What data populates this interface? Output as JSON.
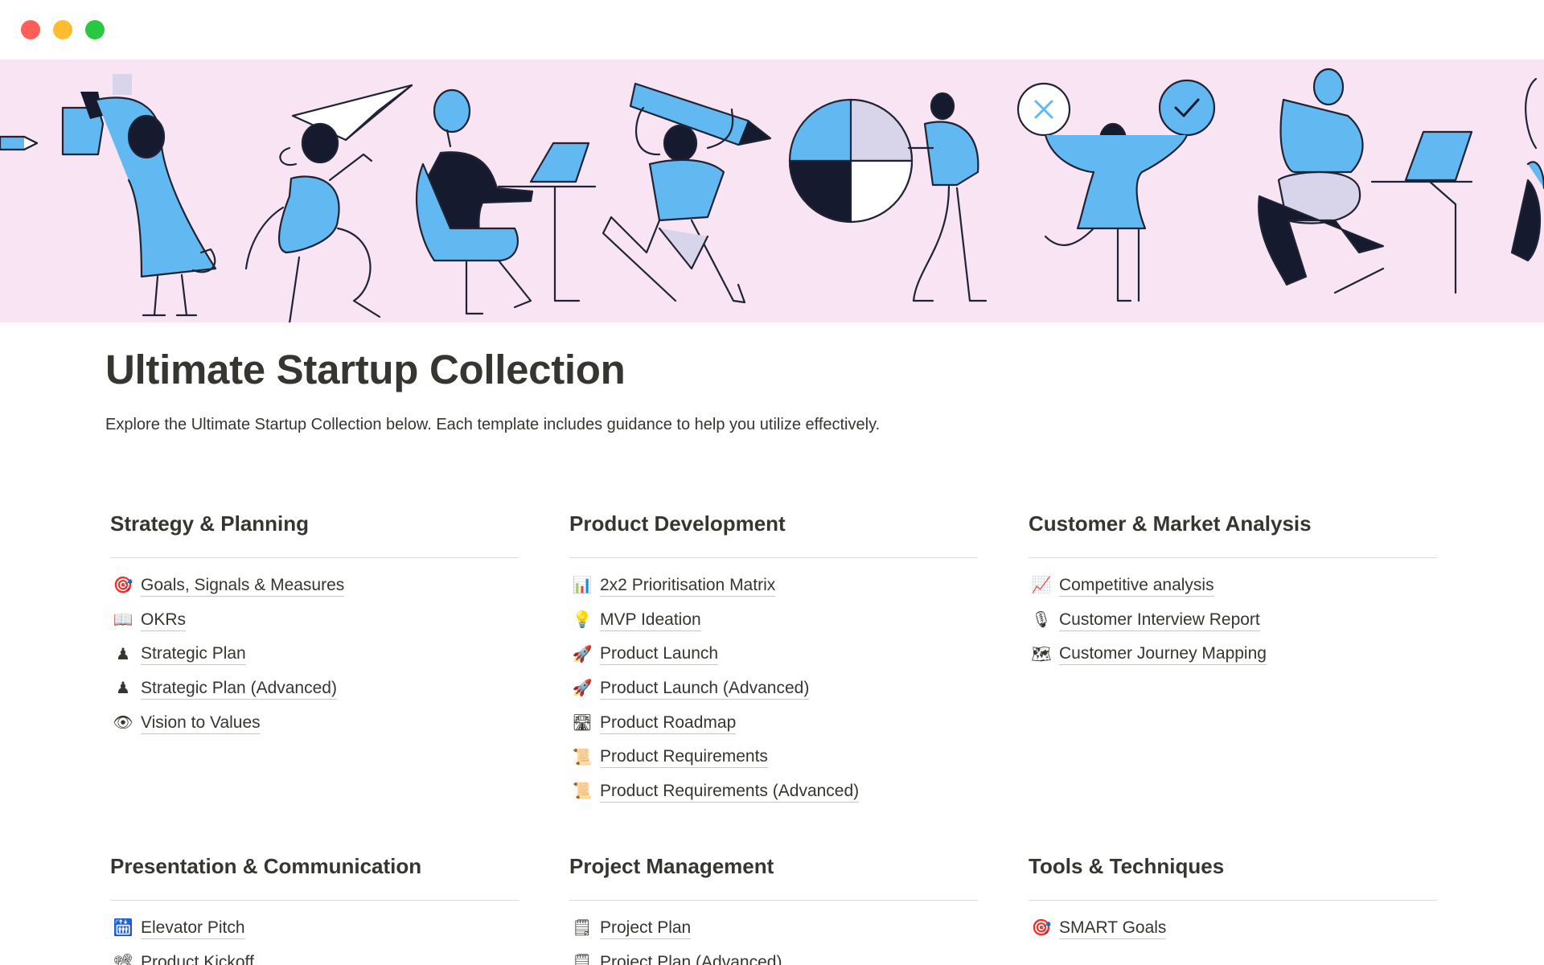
{
  "window": {
    "controls": [
      "close",
      "minimize",
      "zoom"
    ]
  },
  "page": {
    "title": "Ultimate Startup Collection",
    "description": "Explore the Ultimate Startup Collection below. Each template includes guidance to help you utilize effectively."
  },
  "sections": [
    {
      "title": "Strategy & Planning",
      "items": [
        {
          "label": "Goals, Signals & Measures",
          "icon": "target-icon",
          "glyph": "🎯"
        },
        {
          "label": "OKRs",
          "icon": "open-book-icon",
          "glyph": "📖"
        },
        {
          "label": "Strategic Plan",
          "icon": "chess-pawn-icon",
          "glyph": "♟"
        },
        {
          "label": "Strategic Plan (Advanced)",
          "icon": "chess-pawn-icon",
          "glyph": "♟"
        },
        {
          "label": "Vision to Values",
          "icon": "eye-icon",
          "glyph": "👁"
        }
      ]
    },
    {
      "title": "Product Development",
      "items": [
        {
          "label": "2x2 Prioritisation Matrix",
          "icon": "bar-chart-icon",
          "glyph": "📊"
        },
        {
          "label": "MVP Ideation",
          "icon": "light-bulb-icon",
          "glyph": "💡"
        },
        {
          "label": "Product Launch",
          "icon": "rocket-icon",
          "glyph": "🚀"
        },
        {
          "label": "Product Launch (Advanced)",
          "icon": "rocket-icon",
          "glyph": "🚀"
        },
        {
          "label": "Product Roadmap",
          "icon": "motorway-icon",
          "glyph": "🛣"
        },
        {
          "label": "Product Requirements",
          "icon": "scroll-icon",
          "glyph": "📜"
        },
        {
          "label": "Product Requirements (Advanced)",
          "icon": "scroll-icon",
          "glyph": "📜"
        }
      ]
    },
    {
      "title": "Customer & Market Analysis",
      "items": [
        {
          "label": "Competitive analysis",
          "icon": "trending-up-chart-icon",
          "glyph": "📈"
        },
        {
          "label": "Customer Interview Report",
          "icon": "microphone-icon",
          "glyph": "🎙"
        },
        {
          "label": "Customer Journey Mapping",
          "icon": "map-icon",
          "glyph": "🗺"
        }
      ]
    },
    {
      "title": "Presentation & Communication",
      "items": [
        {
          "label": "Elevator Pitch",
          "icon": "elevator-icon",
          "glyph": "🛗"
        },
        {
          "label": "Product Kickoff",
          "icon": "project-icon",
          "glyph": "📽"
        }
      ]
    },
    {
      "title": "Project Management",
      "items": [
        {
          "label": "Project Plan",
          "icon": "spiral-notepad-icon",
          "glyph": "🗒"
        },
        {
          "label": "Project Plan (Advanced)",
          "icon": "spiral-notepad-icon",
          "glyph": "🗒"
        }
      ]
    },
    {
      "title": "Tools & Techniques",
      "items": [
        {
          "label": "SMART Goals",
          "icon": "target-icon",
          "glyph": "🎯"
        }
      ]
    }
  ],
  "colors": {
    "cover_background": "#f9e4f4",
    "illustration_blue": "#62b8f0",
    "illustration_navy": "#161a2e",
    "illustration_lavender": "#d8d4ea",
    "text": "#37352f",
    "divider": "#dcdbd7"
  }
}
